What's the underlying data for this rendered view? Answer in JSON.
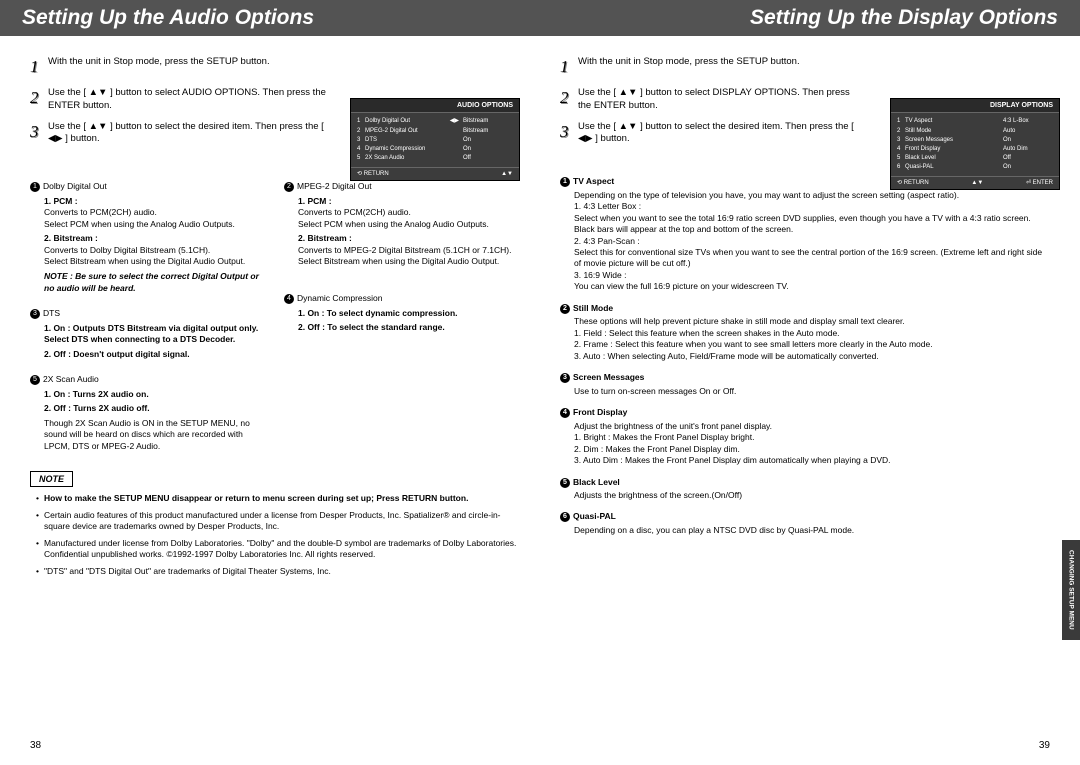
{
  "left": {
    "title": "Setting Up the Audio Options",
    "steps": [
      {
        "n": "1",
        "t": "With the unit in Stop mode, press the SETUP button."
      },
      {
        "n": "2",
        "t": "Use the [ ▲▼ ] button to select AUDIO OPTIONS. Then press the ENTER button."
      },
      {
        "n": "3",
        "t": "Use the [ ▲▼ ] button to select the desired item. Then press the [ ◀▶ ] button."
      }
    ],
    "osd": {
      "title": "AUDIO OPTIONS",
      "rows": [
        {
          "n": "1",
          "l": "Dolby Digital Out",
          "v": "Bitstream"
        },
        {
          "n": "2",
          "l": "MPEG-2 Digital Out",
          "v": "Bitstream"
        },
        {
          "n": "3",
          "l": "DTS",
          "v": "On"
        },
        {
          "n": "4",
          "l": "Dynamic Compression",
          "v": "On"
        },
        {
          "n": "5",
          "l": "2X Scan Audio",
          "v": "Off"
        }
      ],
      "return": "RETURN",
      "nav": "▲▼"
    },
    "col1": {
      "h1": "Dolby Digital Out",
      "h1_1b": "1. PCM :",
      "h1_1t": "Converts to PCM(2CH) audio.\nSelect PCM when using the Analog Audio Outputs.",
      "h1_2b": "2. Bitstream :",
      "h1_2t": "Converts to Dolby Digital Bitstream (5.1CH).\nSelect Bitstream when using the Digital Audio Output.",
      "h1_note": "NOTE : Be sure to select the correct Digital Output or no audio will be heard.",
      "h3": "DTS",
      "h3_1": "1. On : Outputs DTS Bitstream via digital output only. Select DTS when connecting to a DTS Decoder.",
      "h3_2": "2. Off : Doesn't output digital signal.",
      "h5": "2X Scan Audio",
      "h5_1": "1. On : Turns 2X audio on.",
      "h5_2": "2. Off : Turns 2X audio off.",
      "h5_t": "Though 2X Scan Audio is ON in the SETUP MENU, no sound will be heard on discs which are recorded with LPCM, DTS or MPEG-2 Audio."
    },
    "col2": {
      "h2": "MPEG-2 Digital Out",
      "h2_1b": "1. PCM :",
      "h2_1t": "Converts to PCM(2CH) audio.\nSelect PCM when using the Analog Audio Outputs.",
      "h2_2b": "2. Bitstream :",
      "h2_2t": "Converts to MPEG-2 Digital Bitstream (5.1CH or 7.1CH).\nSelect Bitstream when using the Digital Audio Output.",
      "h4": "Dynamic Compression",
      "h4_1": "1. On : To select dynamic compression.",
      "h4_2": "2. Off : To select the standard range."
    },
    "note_title": "NOTE",
    "notes": [
      "How to make the SETUP MENU disappear or return to menu screen during set up; Press RETURN button.",
      "Certain audio features of this product manufactured under a license from Desper Products, Inc. Spatializer® and circle-in-square device are trademarks owned by Desper Products, Inc.",
      "Manufactured under license from Dolby Laboratories. \"Dolby\" and the double-D symbol are trademarks of Dolby Laboratories. Confidential unpublished works. ©1992-1997 Dolby Laboratories Inc. All rights reserved.",
      "\"DTS\" and \"DTS Digital Out\" are trademarks of Digital Theater Systems, Inc."
    ],
    "pagenum": "38"
  },
  "right": {
    "title": "Setting Up the Display Options",
    "steps": [
      {
        "n": "1",
        "t": "With the unit in Stop mode, press the SETUP button."
      },
      {
        "n": "2",
        "t": "Use the [ ▲▼ ] button to select DISPLAY OPTIONS. Then press the ENTER button."
      },
      {
        "n": "3",
        "t": "Use the [ ▲▼ ] button to select the desired item. Then press the [ ◀▶ ] button."
      }
    ],
    "osd": {
      "title": "DISPLAY OPTIONS",
      "rows": [
        {
          "n": "1",
          "l": "TV Aspect",
          "v": "4:3   L-Box"
        },
        {
          "n": "2",
          "l": "Still Mode",
          "v": "Auto"
        },
        {
          "n": "3",
          "l": "Screen Messages",
          "v": "On"
        },
        {
          "n": "4",
          "l": "Front Display",
          "v": "Auto Dim"
        },
        {
          "n": "5",
          "l": "Black Level",
          "v": "Off"
        },
        {
          "n": "6",
          "l": "Quasi-PAL",
          "v": "On"
        }
      ],
      "return": "RETURN",
      "nav": "▲▼",
      "enter": "ENTER"
    },
    "sections": {
      "s1": {
        "h": "TV Aspect",
        "intro": "Depending on the type of television you have, you may want to adjust the screen setting (aspect ratio).",
        "i1": "1. 4:3 Letter Box :\nSelect when you want to see the total 16:9 ratio screen DVD supplies, even though you have a TV with a 4:3 ratio screen. Black bars will appear at the top and bottom of the screen.",
        "i2": "2. 4:3 Pan-Scan :\nSelect this for conventional size TVs when you want to see the central portion of the 16:9 screen. (Extreme left and right side of movie picture will be cut off.)",
        "i3": "3. 16:9 Wide :\nYou can view the full 16:9 picture on your widescreen TV."
      },
      "s2": {
        "h": "Still Mode",
        "intro": "These options will help prevent picture shake in still mode and display small text clearer.",
        "i1": "1. Field : Select this feature when the screen shakes in the Auto mode.",
        "i2": "2. Frame : Select this feature when you want to see small letters more clearly in the Auto mode.",
        "i3": "3. Auto : When selecting Auto, Field/Frame mode will be automatically converted."
      },
      "s3": {
        "h": "Screen Messages",
        "t": "Use to turn on-screen messages On or Off."
      },
      "s4": {
        "h": "Front Display",
        "intro": "Adjust the brightness of the unit's front panel display.",
        "i1": "1. Bright : Makes the Front Panel Display bright.",
        "i2": "2. Dim : Makes the Front Panel Display dim.",
        "i3": "3. Auto Dim : Makes the Front Panel Display dim automatically when playing a DVD."
      },
      "s5": {
        "h": "Black Level",
        "t": "Adjusts the brightness of the screen.(On/Off)"
      },
      "s6": {
        "h": "Quasi-PAL",
        "t": "Depending on a disc, you can play a NTSC DVD disc by Quasi-PAL mode."
      }
    },
    "side_tab": "CHANGING SETUP MENU",
    "pagenum": "39"
  }
}
